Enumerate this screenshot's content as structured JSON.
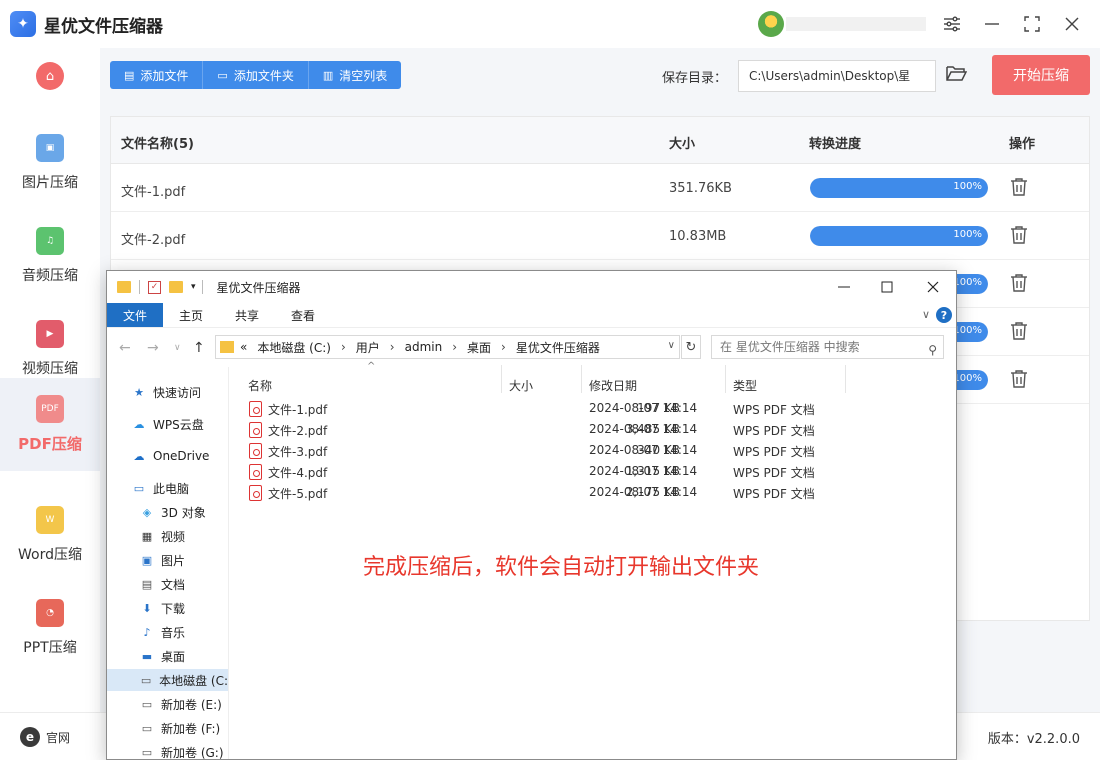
{
  "app": {
    "title": "星优文件压缩器",
    "version": "版本：v2.2.0.0"
  },
  "colors": {
    "accent": "#3f8bea",
    "danger": "#f26a6a"
  },
  "sidebar": {
    "items": [
      {
        "label": "图片压缩",
        "icon": "image-icon"
      },
      {
        "label": "音频压缩",
        "icon": "audio-icon"
      },
      {
        "label": "视频压缩",
        "icon": "video-icon"
      },
      {
        "label": "PDF压缩",
        "icon": "pdf-icon",
        "active": true
      },
      {
        "label": "Word压缩",
        "icon": "word-icon"
      },
      {
        "label": "PPT压缩",
        "icon": "ppt-icon"
      }
    ]
  },
  "toolbar": {
    "add_file": "添加文件",
    "add_folder": "添加文件夹",
    "clear_list": "清空列表",
    "save_label": "保存目录：",
    "save_path": "C:\\Users\\admin\\Desktop\\星",
    "start": "开始压缩"
  },
  "table": {
    "headers": {
      "name": "文件名称(5)",
      "size": "大小",
      "progress": "转换进度",
      "action": "操作"
    },
    "rows": [
      {
        "name": "文件-1.pdf",
        "size": "351.76KB",
        "progress": 1.0,
        "pct": "100%"
      },
      {
        "name": "文件-2.pdf",
        "size": "10.83MB",
        "progress": 1.0,
        "pct": "100%"
      },
      {
        "name": "",
        "size": "",
        "progress": 1.0,
        "pct": "100%"
      },
      {
        "name": "",
        "size": "",
        "progress": 1.0,
        "pct": "100%"
      },
      {
        "name": "",
        "size": "",
        "progress": 1.0,
        "pct": "100%"
      }
    ]
  },
  "footer": {
    "website": "官网"
  },
  "explorer": {
    "title": "星优文件压缩器",
    "ribbon": [
      "文件",
      "主页",
      "共享",
      "查看"
    ],
    "address": [
      "«",
      "本地磁盘 (C:)",
      "用户",
      "admin",
      "桌面",
      "星优文件压缩器"
    ],
    "search_placeholder": "在 星优文件压缩器 中搜索",
    "columns": {
      "name": "名称",
      "size": "大小",
      "date": "修改日期",
      "type": "类型"
    },
    "nav": [
      {
        "label": "快速访问",
        "icon": "star-icon"
      },
      {
        "label": "WPS云盘",
        "icon": "cloud-icon"
      },
      {
        "label": "OneDrive",
        "icon": "onedrive-icon"
      },
      {
        "label": "此电脑",
        "icon": "computer-icon"
      },
      {
        "label": "3D 对象",
        "icon": "cube-icon"
      },
      {
        "label": "视频",
        "icon": "film-icon"
      },
      {
        "label": "图片",
        "icon": "picture-icon"
      },
      {
        "label": "文档",
        "icon": "document-icon"
      },
      {
        "label": "下载",
        "icon": "download-icon"
      },
      {
        "label": "音乐",
        "icon": "music-icon"
      },
      {
        "label": "桌面",
        "icon": "desktop-icon"
      },
      {
        "label": "本地磁盘 (C:",
        "icon": "drive-icon",
        "selected": true
      },
      {
        "label": "新加卷 (E:)",
        "icon": "drive-icon"
      },
      {
        "label": "新加卷 (F:)",
        "icon": "drive-icon"
      },
      {
        "label": "新加卷 (G:)",
        "icon": "drive-icon"
      }
    ],
    "files": [
      {
        "name": "文件-1.pdf",
        "size": "197 KB",
        "date": "2024-08-07 14:14",
        "type": "WPS PDF 文档"
      },
      {
        "name": "文件-2.pdf",
        "size": "3,485 KB",
        "date": "2024-08-07 14:14",
        "type": "WPS PDF 文档"
      },
      {
        "name": "文件-3.pdf",
        "size": "340 KB",
        "date": "2024-08-07 14:14",
        "type": "WPS PDF 文档"
      },
      {
        "name": "文件-4.pdf",
        "size": "1,315 KB",
        "date": "2024-08-07 14:14",
        "type": "WPS PDF 文档"
      },
      {
        "name": "文件-5.pdf",
        "size": "2,175 KB",
        "date": "2024-08-07 14:14",
        "type": "WPS PDF 文档"
      }
    ]
  },
  "annotation": "完成压缩后，软件会自动打开输出文件夹"
}
